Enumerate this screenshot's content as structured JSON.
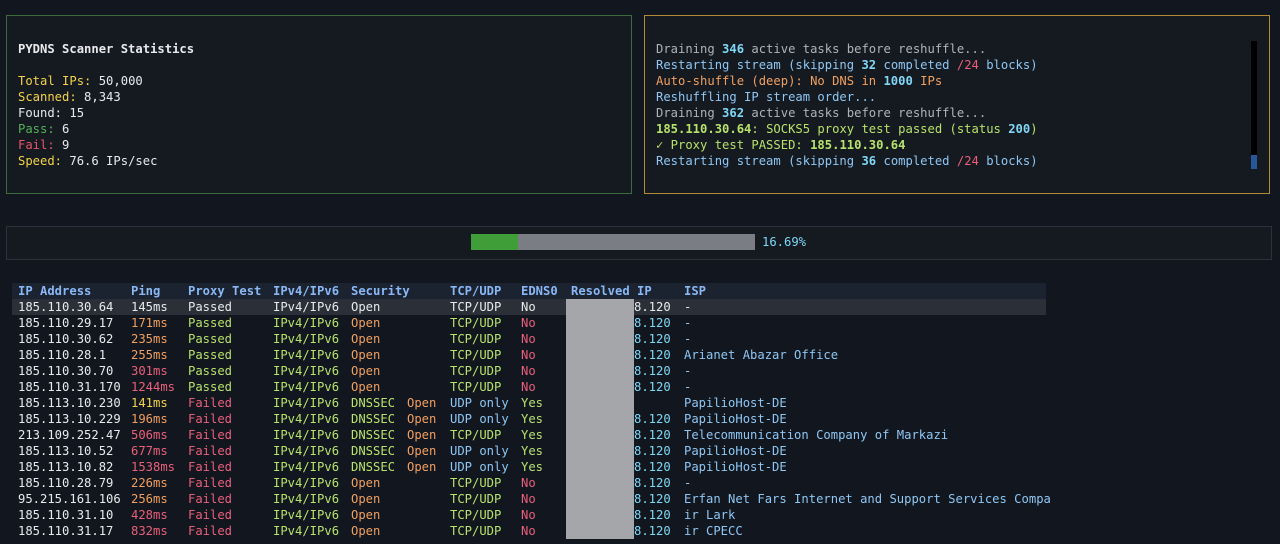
{
  "stats": {
    "title": "PYDNS Scanner Statistics",
    "total_label": "Total IPs:",
    "total_value": "50,000",
    "scanned_label": "Scanned:",
    "scanned_value": "8,343",
    "found_label": "Found:",
    "found_value": "15",
    "pass_label": "Pass:",
    "pass_value": "6",
    "fail_label": "Fail:",
    "fail_value": "9",
    "speed_label": "Speed:",
    "speed_value": "76.6 IPs/sec"
  },
  "log": [
    [
      {
        "t": "Draining ",
        "c": "c-gray"
      },
      {
        "t": "346",
        "c": "c-cyan bold"
      },
      {
        "t": " active tasks before reshuffle...",
        "c": "c-gray"
      }
    ],
    [
      {
        "t": "Restarting stream (skipping ",
        "c": "c-blue"
      },
      {
        "t": "32",
        "c": "c-cyan bold"
      },
      {
        "t": " completed ",
        "c": "c-blue"
      },
      {
        "t": "/24",
        "c": "c-pink"
      },
      {
        "t": " blocks)",
        "c": "c-blue"
      }
    ],
    [
      {
        "t": "Auto-shuffle (deep): No DNS in ",
        "c": "c-orange"
      },
      {
        "t": "1000",
        "c": "c-cyan bold"
      },
      {
        "t": " IPs",
        "c": "c-orange"
      }
    ],
    [
      {
        "t": "Reshuffling IP stream order...",
        "c": "c-blue"
      }
    ],
    [
      {
        "t": "Draining ",
        "c": "c-gray"
      },
      {
        "t": "362",
        "c": "c-cyan bold"
      },
      {
        "t": " active tasks before reshuffle...",
        "c": "c-gray"
      }
    ],
    [
      {
        "t": "185.110.30.64",
        "c": "c-lime bold"
      },
      {
        "t": ": SOCKS5 proxy test passed (status ",
        "c": "c-lime"
      },
      {
        "t": "200",
        "c": "c-cyan bold"
      },
      {
        "t": ")",
        "c": "c-lime"
      }
    ],
    [
      {
        "t": "✓ Proxy test PASSED: ",
        "c": "c-lime"
      },
      {
        "t": "185.110.30.64",
        "c": "c-lime bold"
      }
    ],
    [
      {
        "t": "Restarting stream (skipping ",
        "c": "c-blue"
      },
      {
        "t": "36",
        "c": "c-cyan bold"
      },
      {
        "t": " completed ",
        "c": "c-blue"
      },
      {
        "t": "/24",
        "c": "c-pink"
      },
      {
        "t": " blocks)",
        "c": "c-blue"
      }
    ]
  ],
  "progress": {
    "value": 0.1669,
    "label": "16.69%"
  },
  "table": {
    "headers": [
      "IP Address",
      "Ping",
      "Proxy Test",
      "IPv4/IPv6",
      "Security",
      "TCP/UDP",
      "EDNS0",
      "Resolved IP",
      "ISP"
    ],
    "rows": [
      {
        "ip": "185.110.30.64",
        "ping": "145ms",
        "proxy": "Passed",
        "ipv": "IPv4/IPv6",
        "sec": "Open",
        "sec2": "",
        "tcp": "TCP/UDP",
        "edns": "No",
        "res": "8.120",
        "isp": "-",
        "sel": true
      },
      {
        "ip": "185.110.29.17",
        "ping": "171ms",
        "proxy": "Passed",
        "ipv": "IPv4/IPv6",
        "sec": "Open",
        "sec2": "",
        "tcp": "TCP/UDP",
        "edns": "No",
        "res": "8.120",
        "isp": "-"
      },
      {
        "ip": "185.110.30.62",
        "ping": "235ms",
        "proxy": "Passed",
        "ipv": "IPv4/IPv6",
        "sec": "Open",
        "sec2": "",
        "tcp": "TCP/UDP",
        "edns": "No",
        "res": "8.120",
        "isp": "-"
      },
      {
        "ip": "185.110.28.1",
        "ping": "255ms",
        "proxy": "Passed",
        "ipv": "IPv4/IPv6",
        "sec": "Open",
        "sec2": "",
        "tcp": "TCP/UDP",
        "edns": "No",
        "res": "8.120",
        "isp": "Arianet Abazar Office"
      },
      {
        "ip": "185.110.30.70",
        "ping": "301ms",
        "proxy": "Passed",
        "ipv": "IPv4/IPv6",
        "sec": "Open",
        "sec2": "",
        "tcp": "TCP/UDP",
        "edns": "No",
        "res": "8.120",
        "isp": "-"
      },
      {
        "ip": "185.110.31.170",
        "ping": "1244ms",
        "proxy": "Passed",
        "ipv": "IPv4/IPv6",
        "sec": "Open",
        "sec2": "",
        "tcp": "TCP/UDP",
        "edns": "No",
        "res": "8.120",
        "isp": "-"
      },
      {
        "ip": "185.113.10.230",
        "ping": "141ms",
        "proxy": "Failed",
        "ipv": "IPv4/IPv6",
        "sec": "DNSSEC",
        "sec2": "Open",
        "tcp": "UDP only",
        "edns": "Yes",
        "res": "",
        "isp": "PapilioHost-DE"
      },
      {
        "ip": "185.113.10.229",
        "ping": "196ms",
        "proxy": "Failed",
        "ipv": "IPv4/IPv6",
        "sec": "DNSSEC",
        "sec2": "Open",
        "tcp": "UDP only",
        "edns": "Yes",
        "res": "8.120",
        "isp": "PapilioHost-DE"
      },
      {
        "ip": "213.109.252.47",
        "ping": "506ms",
        "proxy": "Failed",
        "ipv": "IPv4/IPv6",
        "sec": "DNSSEC",
        "sec2": "Open",
        "tcp": "TCP/UDP",
        "edns": "Yes",
        "res": "8.120",
        "isp": "Telecommunication Company of Markazi"
      },
      {
        "ip": "185.113.10.52",
        "ping": "677ms",
        "proxy": "Failed",
        "ipv": "IPv4/IPv6",
        "sec": "DNSSEC",
        "sec2": "Open",
        "tcp": "UDP only",
        "edns": "Yes",
        "res": "8.120",
        "isp": "PapilioHost-DE"
      },
      {
        "ip": "185.113.10.82",
        "ping": "1538ms",
        "proxy": "Failed",
        "ipv": "IPv4/IPv6",
        "sec": "DNSSEC",
        "sec2": "Open",
        "tcp": "UDP only",
        "edns": "Yes",
        "res": "8.120",
        "isp": "PapilioHost-DE"
      },
      {
        "ip": "185.110.28.79",
        "ping": "226ms",
        "proxy": "Failed",
        "ipv": "IPv4/IPv6",
        "sec": "Open",
        "sec2": "",
        "tcp": "TCP/UDP",
        "edns": "No",
        "res": "8.120",
        "isp": "-"
      },
      {
        "ip": "95.215.161.106",
        "ping": "256ms",
        "proxy": "Failed",
        "ipv": "IPv4/IPv6",
        "sec": "Open",
        "sec2": "",
        "tcp": "TCP/UDP",
        "edns": "No",
        "res": "8.120",
        "isp": "Erfan Net Fars Internet and Support Services Compa"
      },
      {
        "ip": "185.110.31.10",
        "ping": "428ms",
        "proxy": "Failed",
        "ipv": "IPv4/IPv6",
        "sec": "Open",
        "sec2": "",
        "tcp": "TCP/UDP",
        "edns": "No",
        "res": "8.120",
        "isp": "ir Lark"
      },
      {
        "ip": "185.110.31.17",
        "ping": "832ms",
        "proxy": "Failed",
        "ipv": "IPv4/IPv6",
        "sec": "Open",
        "sec2": "",
        "tcp": "TCP/UDP",
        "edns": "No",
        "res": "8.120",
        "isp": "ir CPECC"
      }
    ]
  }
}
